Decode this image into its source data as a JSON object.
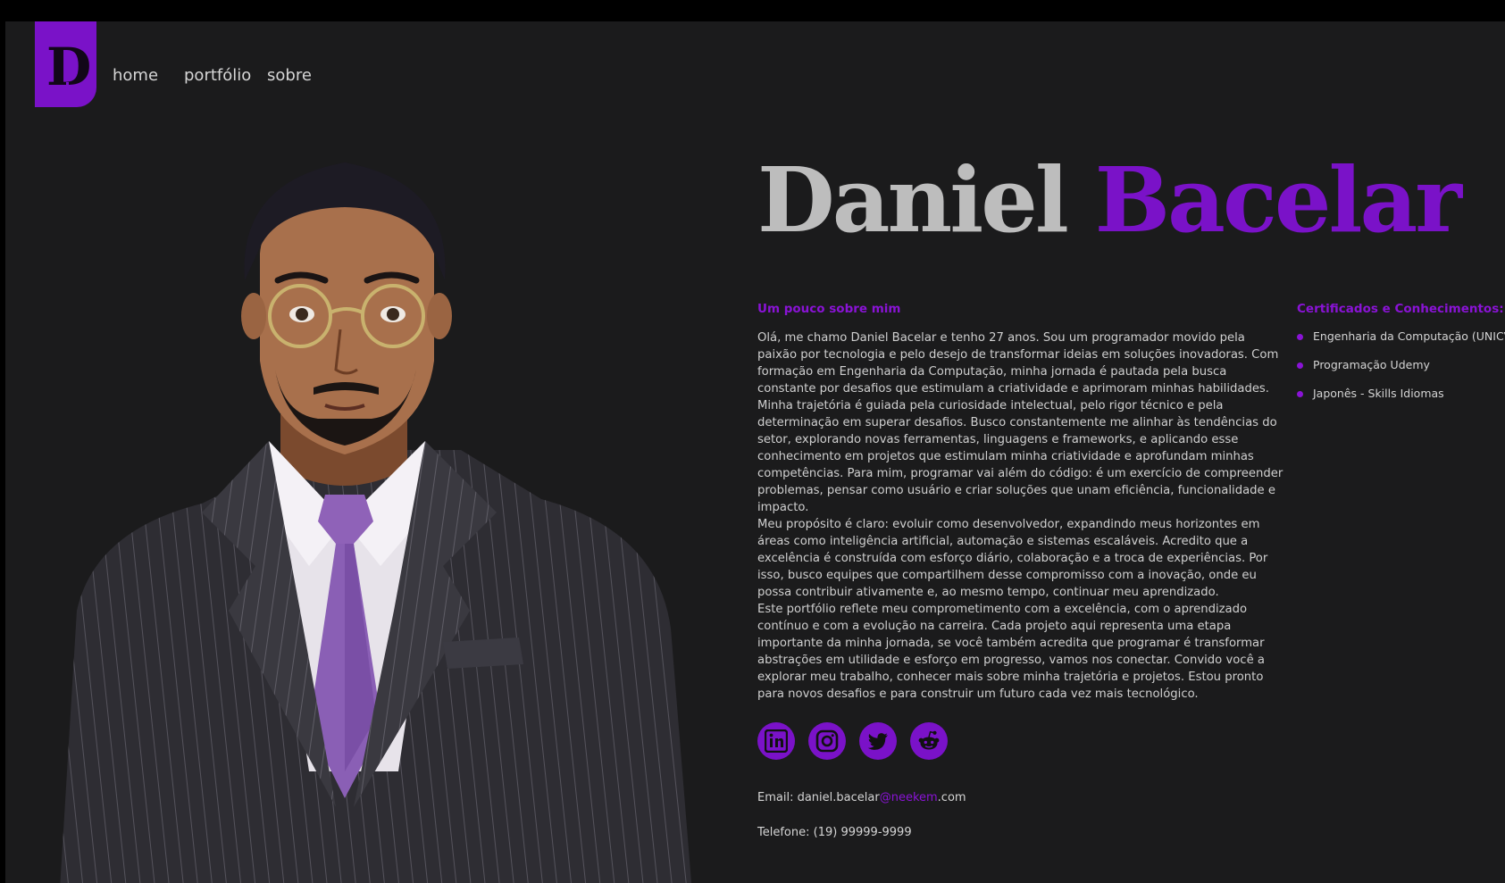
{
  "logo": {
    "letter": "D"
  },
  "nav": {
    "items": [
      "home",
      "portfólio",
      "sobre"
    ]
  },
  "hero": {
    "first_name": "Daniel",
    "last_name": "Bacelar"
  },
  "about": {
    "title": "Um pouco sobre mim",
    "paragraphs": [
      "Olá, me chamo Daniel Bacelar e tenho 27 anos. Sou um programador movido pela paixão por tecnologia e pelo desejo de transformar ideias em soluções inovadoras. Com formação em Engenharia da Computação, minha jornada é pautada pela busca constante por desafios que estimulam a criatividade e aprimoram minhas habilidades. Minha trajetória é guiada pela curiosidade intelectual, pelo rigor técnico e pela determinação em superar desafios. Busco constantemente me alinhar às tendências do setor, explorando novas ferramentas, linguagens e frameworks, e aplicando esse conhecimento em projetos que estimulam minha criatividade e aprofundam minhas competências. Para mim, programar vai além do código: é um exercício de compreender problemas, pensar como usuário e criar soluções que unam eficiência, funcionalidade e impacto.",
      "Meu propósito é claro: evoluir como desenvolvedor, expandindo meus horizontes em áreas como inteligência artificial, automação e sistemas escaláveis. Acredito que a excelência é construída com esforço diário, colaboração e a troca de experiências. Por isso, busco equipes que compartilhem desse compromisso com a inovação, onde eu possa contribuir ativamente e, ao mesmo tempo, continuar meu aprendizado.",
      "Este portfólio reflete meu comprometimento com a excelência, com o aprendizado contínuo e com a evolução na carreira. Cada projeto aqui representa uma etapa importante da minha jornada, se você também acredita que programar é transformar abstrações em utilidade e esforço em progresso, vamos nos conectar. Convido você a explorar meu trabalho, conhecer mais sobre minha trajetória e projetos. Estou pronto para novos desafios e para construir um futuro cada vez mais tecnológico."
    ]
  },
  "certificates": {
    "title": "Certificados e Conhecimentos:",
    "items": [
      "Engenharia da Computação (UNICV)",
      "Programação Udemy",
      "Japonês - Skills Idiomas"
    ]
  },
  "socials": [
    "linkedin-icon",
    "instagram-icon",
    "twitter-icon",
    "reddit-icon"
  ],
  "contact": {
    "email_label": "Email:",
    "email_user": "daniel.bacelar",
    "email_domain": "@neekem",
    "email_tld": ".com",
    "phone_label": "Telefone:",
    "phone": "(19) 99999-9999"
  },
  "colors": {
    "accent": "#7a12c8",
    "background": "#1b1b1c",
    "name_gray": "#bdbdbd"
  }
}
